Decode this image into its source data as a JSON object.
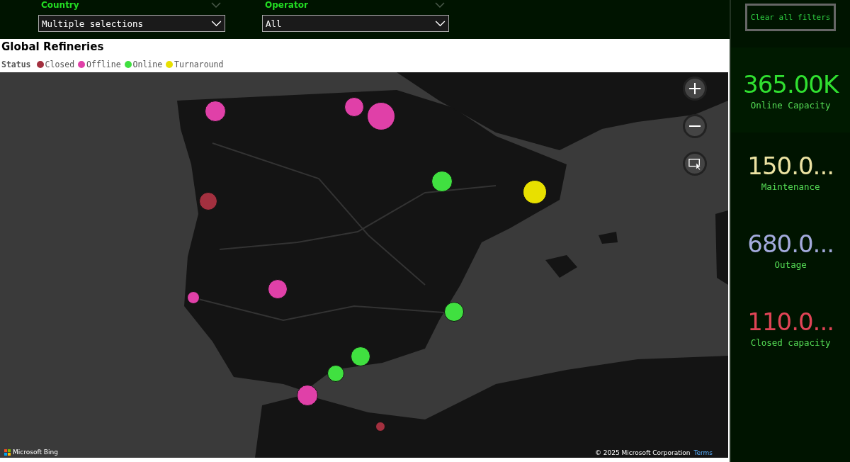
{
  "filters": [
    {
      "label": "Country",
      "value": "Multiple selections"
    },
    {
      "label": "Operator",
      "value": "All"
    }
  ],
  "clear_button": "Clear all filters",
  "visual": {
    "title": "Global Refineries",
    "legend_title": "Status",
    "legend": [
      {
        "label": "Closed",
        "color": "#a3303f"
      },
      {
        "label": "Offline",
        "color": "#e040a8"
      },
      {
        "label": "Online",
        "color": "#40e040"
      },
      {
        "label": "Turnaround",
        "color": "#e8e000"
      }
    ],
    "map": {
      "kind": "picture",
      "markers": [
        {
          "color": "#e040a8"
        },
        {
          "color": "#e040a8"
        },
        {
          "color": "#e040a8"
        },
        {
          "color": "#40e040"
        },
        {
          "color": "#e8e000"
        },
        {
          "color": "#a3303f"
        },
        {
          "color": "#e040a8"
        },
        {
          "color": "#e040a8"
        },
        {
          "color": "#40e040"
        },
        {
          "color": "#40e040"
        },
        {
          "color": "#40e040"
        },
        {
          "color": "#e040a8"
        },
        {
          "color": "#a3303f"
        }
      ],
      "attribution": "Microsoft Bing",
      "copyright": "© 2025 Microsoft Corporation",
      "terms": "Terms"
    }
  },
  "kpis": [
    {
      "value": "365.00K",
      "label": "Online Capacity",
      "color": "#30e030"
    },
    {
      "value": "150.0...",
      "label": "Maintenance",
      "color": "#ece3a2"
    },
    {
      "value": "680.0...",
      "label": "Outage",
      "color": "#a3aadc"
    },
    {
      "value": "110.0...",
      "label": "Closed capacity",
      "color": "#e04456"
    }
  ]
}
